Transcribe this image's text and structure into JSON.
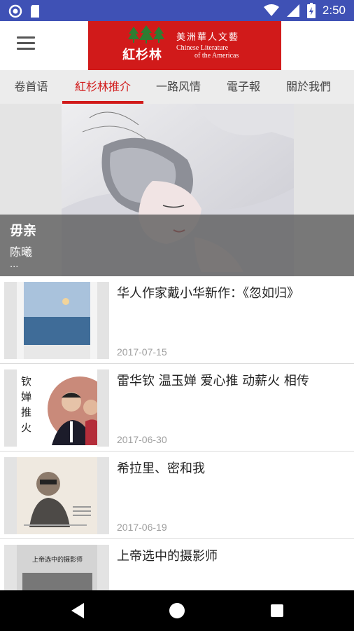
{
  "status_bar": {
    "time": "2:50",
    "icons": [
      "notification-circle-icon",
      "sd-card-icon",
      "wifi-icon",
      "signal-icon",
      "battery-icon"
    ],
    "background": "#3f51b5"
  },
  "app_bar": {
    "menu_icon": "hamburger-menu-icon",
    "logo": {
      "name_cn": "紅杉林",
      "tagline_cn": "美洲華人文藝",
      "tagline_en_1": "Chinese Literature",
      "tagline_en_2": "of the Americas",
      "background": "#d11a1a"
    }
  },
  "tabs": [
    {
      "label": "卷首语",
      "active": false
    },
    {
      "label": "紅杉林推介",
      "active": true
    },
    {
      "label": "一路风情",
      "active": false
    },
    {
      "label": "電子報",
      "active": false
    },
    {
      "label": "關於我們",
      "active": false
    }
  ],
  "accent_color": "#d11a1a",
  "hero": {
    "title": "毋亲",
    "author": "陈曦",
    "more": "..."
  },
  "articles": [
    {
      "title": "华人作家戴小华新作：《忽如归》",
      "date": "2017-07-15"
    },
    {
      "title": "雷华钦 温玉婵 爱心推 动薪火 相传",
      "date": "2017-06-30"
    },
    {
      "title": "希拉里、密和我",
      "date": "2017-06-19"
    },
    {
      "title": "上帝选中的摄影师",
      "date": ""
    }
  ],
  "thumb_text": {
    "poster_chars": "钦\n婵\n推\n火",
    "book_cover_title": "上帝选中的摄影师"
  },
  "nav_bar": {
    "icons": [
      "back-triangle-icon",
      "home-circle-icon",
      "recents-square-icon"
    ]
  }
}
